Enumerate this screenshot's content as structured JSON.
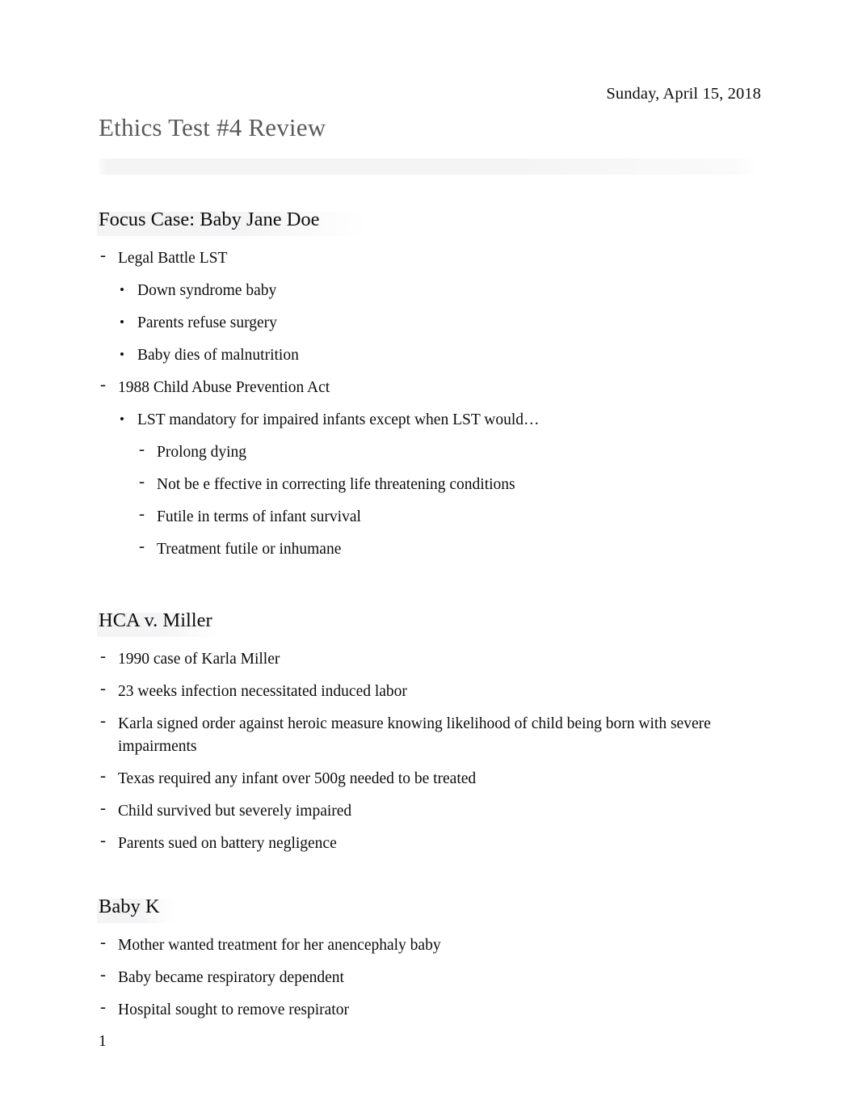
{
  "document": {
    "date": "Sunday, April 15, 2018",
    "title": "Ethics Test #4 Review",
    "page_number": "1",
    "markers": {
      "dash": "-",
      "dot": "•"
    },
    "colors": {
      "title": "#5a5a5a",
      "body_text": "#0d0d0d",
      "highlight_band": "#f3f3f4",
      "page_background": "#ffffff"
    }
  },
  "sections": [
    {
      "heading": "Focus Case: Baby Jane Doe",
      "heading_shade_width": 336,
      "items": [
        {
          "level": 1,
          "text": "Legal Battle LST"
        },
        {
          "level": 2,
          "text": "Down syndrome baby"
        },
        {
          "level": 2,
          "text": "Parents refuse surgery"
        },
        {
          "level": 2,
          "text": "Baby dies of malnutrition"
        },
        {
          "level": 1,
          "text": "1988 Child Abuse Prevention Act"
        },
        {
          "level": 2,
          "text": "LST mandatory for impaired infants except when LST would…"
        },
        {
          "level": 3,
          "text": "Prolong dying"
        },
        {
          "level": 3,
          "text": "Not be e  ffective in correcting life threatening conditions"
        },
        {
          "level": 3,
          "text": "Futile in terms of infant survival"
        },
        {
          "level": 3,
          "text": "Treatment futile or inhumane"
        }
      ]
    },
    {
      "heading": "HCA v. Miller",
      "heading_shade_width": 152,
      "items": [
        {
          "level": 1,
          "text": "1990 case of Karla Miller"
        },
        {
          "level": 1,
          "text": "23 weeks infection necessitated induced labor"
        },
        {
          "level": 1,
          "text": "Karla signed order against heroic measure knowing likelihood of child being born with severe impairments"
        },
        {
          "level": 1,
          "text": "Texas required any infant over 500g needed to be treated"
        },
        {
          "level": 1,
          "text": "Child survived but severely impaired"
        },
        {
          "level": 1,
          "text": "Parents sued on battery negligence"
        }
      ]
    },
    {
      "heading": "Baby K",
      "heading_shade_width": 98,
      "items": [
        {
          "level": 1,
          "text": "Mother wanted treatment for her anencephaly baby"
        },
        {
          "level": 1,
          "text": "Baby became respiratory dependent"
        },
        {
          "level": 1,
          "text": "Hospital sought to remove respirator"
        }
      ]
    }
  ]
}
